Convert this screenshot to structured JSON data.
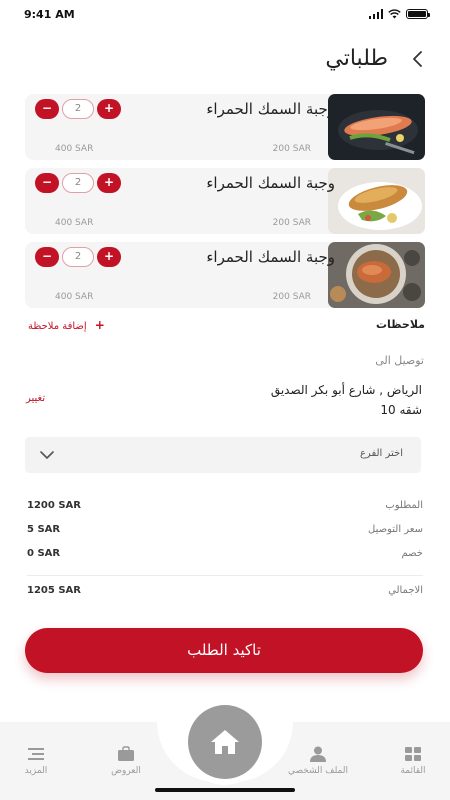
{
  "status_bar": {
    "time": "9:41 AM"
  },
  "header": {
    "title": "طلباتي",
    "back_icon": "chevron-left-icon"
  },
  "cart": {
    "items": [
      {
        "name": "وجبة السمك الحمراء",
        "quantity": "2",
        "unit_price": "200 SAR",
        "total_price": "400 SAR",
        "minus": "−",
        "plus": "+"
      },
      {
        "name": "وجبة السمك الحمراء",
        "quantity": "2",
        "unit_price": "200 SAR",
        "total_price": "400 SAR",
        "minus": "−",
        "plus": "+"
      },
      {
        "name": "وجبة السمك الحمراء",
        "quantity": "2",
        "unit_price": "200 SAR",
        "total_price": "400 SAR",
        "minus": "−",
        "plus": "+"
      }
    ]
  },
  "notes": {
    "label": "ملاحظات",
    "add_label": "إضافة ملاحظة",
    "plus": "+"
  },
  "delivery": {
    "label": "توصيل الى",
    "address_line1": "الرياض , شارع أبو بكر الصديق",
    "address_line2": "شقه 10",
    "change_label": "تغيير"
  },
  "branch": {
    "placeholder": "اختر الفرع"
  },
  "summary": {
    "subtotal_label": "المطلوب",
    "subtotal_value": "1200 SAR",
    "delivery_label": "سعر التوصيل",
    "delivery_value": "5 SAR",
    "discount_label": "خصم",
    "discount_value": "0 SAR",
    "total_label": "الاجمالي",
    "total_value": "1205 SAR"
  },
  "confirm": {
    "label": "تاكيد الطلب"
  },
  "nav": {
    "menu": "القائمة",
    "profile": "الملف الشخصي",
    "offers": "العروض",
    "more": "المزيد"
  },
  "colors": {
    "accent": "#c21226",
    "card": "#f5f5f6",
    "nav": "#f5f5f6"
  }
}
